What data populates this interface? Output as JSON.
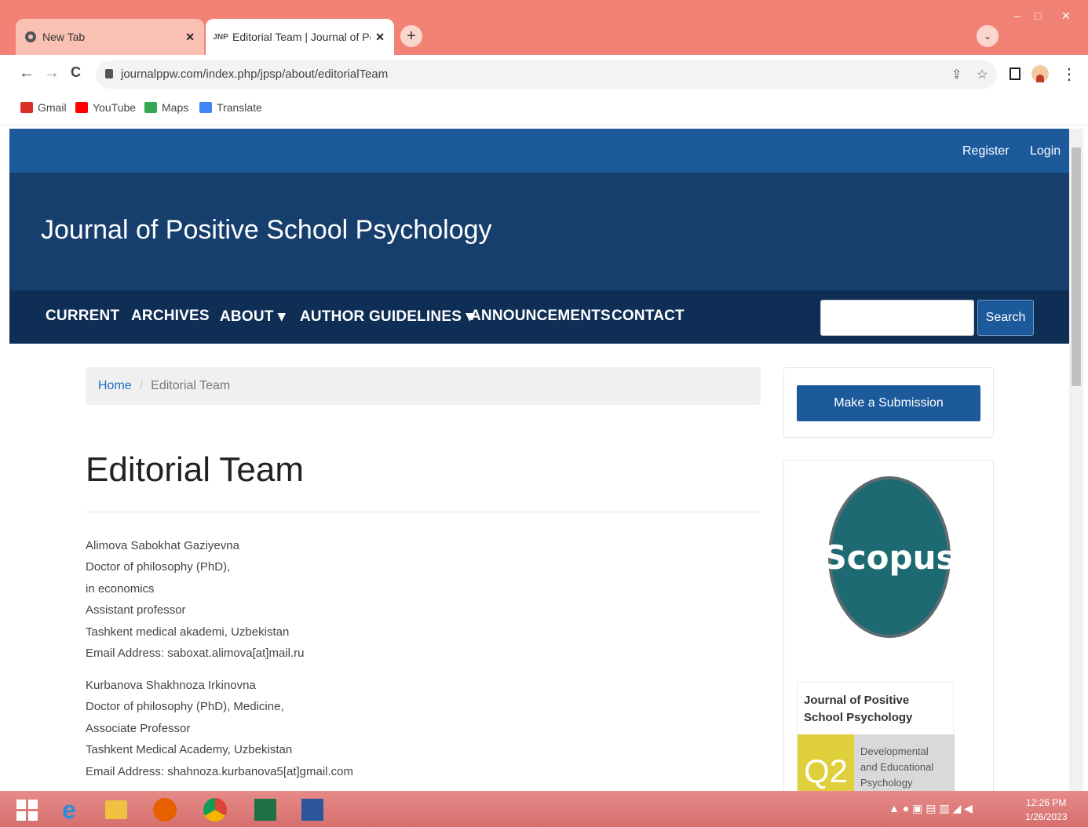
{
  "browser": {
    "tabs": [
      {
        "title": "New Tab",
        "favicon": "chrome-icon"
      },
      {
        "title": "Editorial Team | Journal of Positi",
        "favicon": "jpsp-favicon",
        "favicon_text": "JNP"
      }
    ],
    "new_tab_symbol": "+",
    "tab_search_symbol": "⌄",
    "window_controls": {
      "minimize": "–",
      "maximize": "□",
      "close": "✕"
    },
    "nav": {
      "back": "←",
      "forward": "→",
      "reload": "C"
    },
    "url": "journalppw.com/index.php/jpsp/about/editorialTeam",
    "bookmarks": [
      {
        "label": "Gmail",
        "color": "#d93025"
      },
      {
        "label": "YouTube",
        "color": "#ff0000"
      },
      {
        "label": "Maps",
        "color": "#34a853"
      },
      {
        "label": "Translate",
        "color": "#4285f4"
      }
    ]
  },
  "site": {
    "user_links": {
      "register": "Register",
      "login": "Login"
    },
    "name": "Journal of Positive School Psychology",
    "nav": [
      {
        "label": "CURRENT"
      },
      {
        "label": "ARCHIVES"
      },
      {
        "label": "ABOUT ▾"
      },
      {
        "label": "AUTHOR GUIDELINES ▾"
      },
      {
        "label": "ANNOUNCEMENTS"
      },
      {
        "label": "CONTACT"
      }
    ],
    "search": {
      "button": "Search",
      "value": ""
    }
  },
  "breadcrumb": {
    "home": "Home",
    "separator": "/",
    "current": "Editorial Team"
  },
  "page_title": "Editorial Team",
  "members": [
    {
      "lines": [
        "Alimova Sabokhat Gaziyevna",
        "Doctor of philosophy (PhD),",
        "in economics",
        "Assistant professor",
        "Tashkent medical akademi, Uzbekistan",
        "Email Address: saboxat.alimova[at]mail.ru"
      ]
    },
    {
      "lines": [
        "Kurbanova Shakhnoza Irkinovna",
        "Doctor of philosophy (PhD), Medicine,",
        "Associate Professor",
        "Tashkent Medical Academy, Uzbekistan",
        "Email Address: shahnoza.kurbanova5[at]gmail.com"
      ]
    }
  ],
  "sidebar": {
    "submit_button": "Make a Submission",
    "scopus": "Scopus",
    "sjr": {
      "journal": "Journal of Positive School Psychology",
      "quartile": "Q2",
      "category": "Developmental and Educational Psychology"
    }
  },
  "taskbar": {
    "clock_time": "12:26 PM",
    "clock_date": "1/26/2023"
  },
  "colors": {
    "userbar": "#1c5a9b",
    "header": "#173f6e",
    "mainnav": "#0f2e55",
    "titlebar": "#f28275"
  }
}
